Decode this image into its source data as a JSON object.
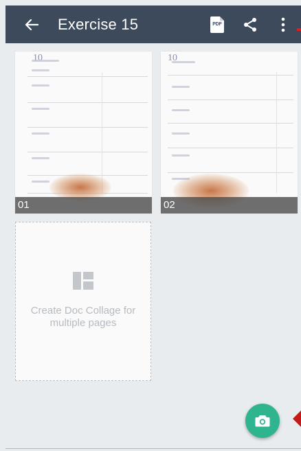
{
  "toolbar": {
    "title": "Exercise 15",
    "back_icon": "arrow-left-icon",
    "pdf_icon": "pdf-file-icon",
    "pdf_text": "PDF",
    "share_icon": "share-icon",
    "more_icon": "more-vertical-icon",
    "background": "#3d4a5c"
  },
  "pages": [
    {
      "label": "01"
    },
    {
      "label": "02"
    }
  ],
  "collage": {
    "icon": "collage-icon",
    "text": "Create Doc Collage for multiple pages"
  },
  "fab": {
    "icon": "camera-icon",
    "color": "#2eb590"
  },
  "accent_marks": {
    "color": "#c51a1a"
  }
}
